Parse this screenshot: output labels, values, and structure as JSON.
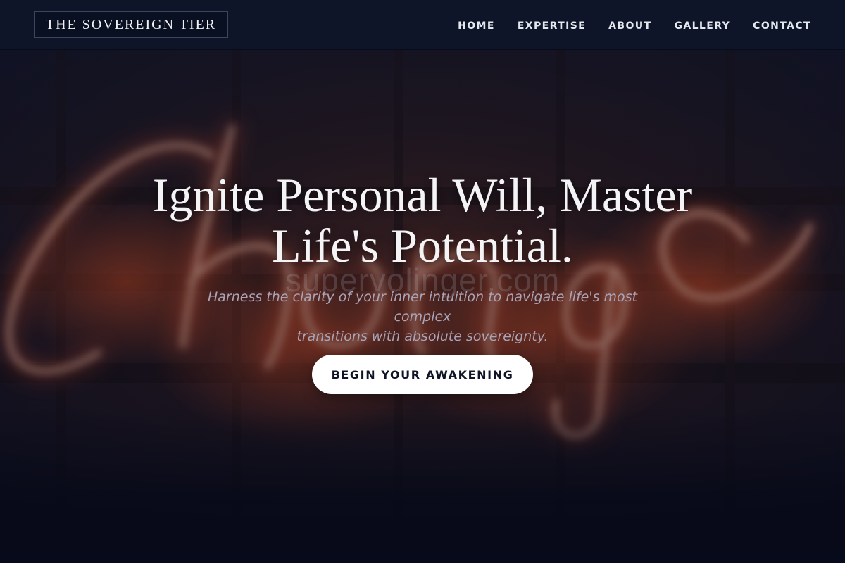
{
  "header": {
    "logo": "THE SOVEREIGN TIER",
    "nav": [
      {
        "label": "HOME"
      },
      {
        "label": "EXPERTISE"
      },
      {
        "label": "ABOUT"
      },
      {
        "label": "GALLERY"
      },
      {
        "label": "CONTACT"
      }
    ]
  },
  "hero": {
    "title_line1": "Ignite Personal Will, Master",
    "title_line2": "Life's Potential.",
    "watermark": "supervolinger.com",
    "subtitle_line1": "Harness the clarity of your inner intuition to navigate life's most complex",
    "subtitle_line2": "transitions with absolute sovereignty.",
    "cta_label": "BEGIN YOUR AWAKENING",
    "background_image": {
      "subject": "neon sign",
      "sign_text": "Change",
      "colors": {
        "neon_glow": "#ff5a2a",
        "neon_tube": "#f3b59a",
        "backdrop": "#2a1a1c"
      }
    }
  },
  "colors": {
    "header_bg": "#0e1528",
    "page_bg": "#080b19",
    "text_primary": "#f4f3f6",
    "button_bg": "#ffffff",
    "button_text": "#0f1426"
  }
}
